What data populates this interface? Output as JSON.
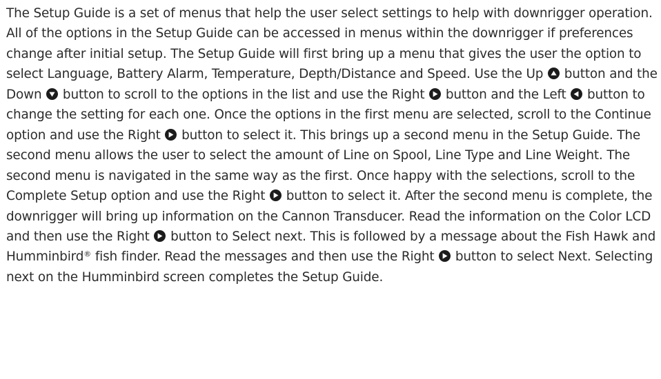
{
  "paragraph": {
    "s1": "The Setup Guide is a set of menus that help the user select settings to help with downrigger operation. All of the options in the Setup Guide can be accessed in menus within the downrigger if preferences change after initial setup. The Setup Guide will first bring up a menu that gives the user the option to select Language, Battery Alarm, Temperature, Depth/Distance and Speed. Use the Up",
    "s2": "button and the Down",
    "s3": "button to scroll to the options in the list and use the Right",
    "s4": "button and the Left",
    "s5": "button to change the setting for each one. Once the options in the first menu are selected, scroll to the Continue option and use the Right",
    "s6": "button to select it. This brings up a second menu in the Setup Guide. The second menu allows the user to select the amount of Line on Spool, Line Type and Line Weight. The second menu is navigated in the same way as the first. Once happy with the selections, scroll to the Complete Setup option and use the Right",
    "s7": "button to select it. After the second menu is complete, the downrigger will bring up information on the Cannon Transducer. Read the information on the Color LCD and then use the Right",
    "s8": "button to Select next. This is followed by a message about the Fish Hawk and Humminbird",
    "registered": "®",
    "s9": "fish finder. Read the messages and then use the Right",
    "s10": "button to select Next. Selecting next on the Humminbird screen completes the Setup Guide."
  },
  "icons": {
    "up": "up-button-icon",
    "down": "down-button-icon",
    "right": "right-button-icon",
    "left": "left-button-icon",
    "color": "#1c1c1c"
  }
}
